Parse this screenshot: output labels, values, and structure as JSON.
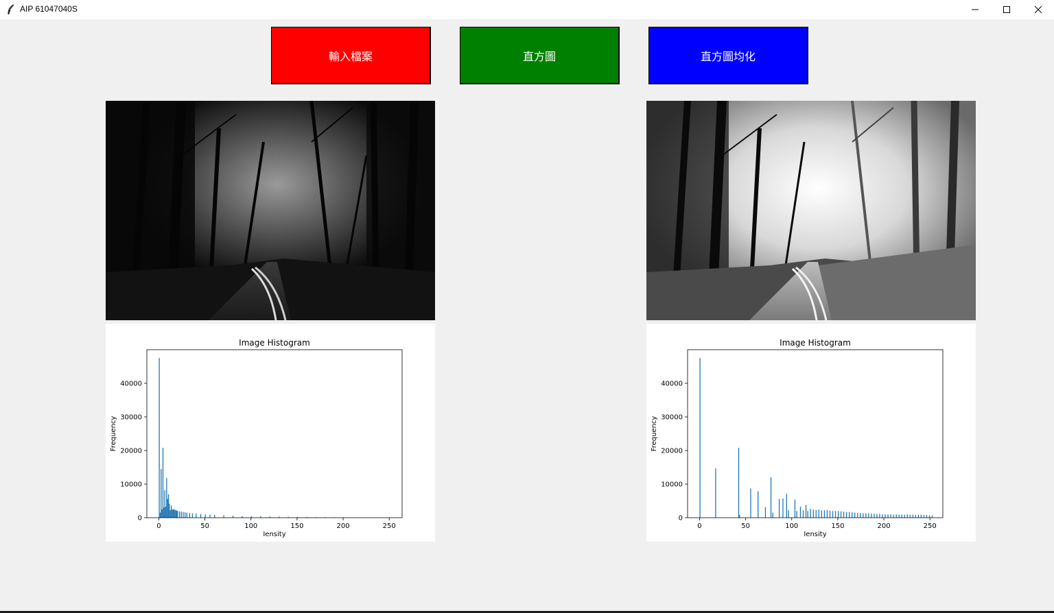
{
  "window": {
    "title": "AIP 61047040S",
    "icon": "feather-icon"
  },
  "toolbar": {
    "input_label": "輸入檔案",
    "histogram_label": "直方圖",
    "equalize_label": "直方圖均化",
    "colors": {
      "input": "#ff0000",
      "histogram": "#008000",
      "equalize": "#0000ff"
    }
  },
  "chart_data": [
    {
      "type": "bar",
      "title": "Image Histogram",
      "xlabel": "Iensity",
      "ylabel": "Frequency",
      "xlim": [
        -13,
        264
      ],
      "ylim": [
        0,
        50000
      ],
      "xticks": [
        0,
        50,
        100,
        150,
        200,
        250
      ],
      "yticks": [
        0,
        10000,
        20000,
        30000,
        40000
      ],
      "color": "#1f77b4",
      "x": [
        0,
        1,
        2,
        3,
        4,
        5,
        6,
        7,
        8,
        9,
        10,
        11,
        12,
        13,
        14,
        15,
        16,
        17,
        18,
        19,
        20,
        22,
        24,
        26,
        28,
        30,
        33,
        36,
        40,
        45,
        50,
        55,
        60,
        70,
        80,
        90,
        100,
        110,
        120,
        130,
        140,
        150,
        160,
        170,
        180,
        190,
        200,
        220,
        240,
        250
      ],
      "values": [
        47500,
        1500,
        14500,
        2500,
        20800,
        3000,
        8200,
        3300,
        11800,
        5600,
        7000,
        4200,
        2200,
        3600,
        2500,
        2400,
        2600,
        2200,
        2300,
        2100,
        2000,
        1900,
        1800,
        1700,
        1600,
        1500,
        1400,
        1300,
        1200,
        1100,
        1000,
        900,
        800,
        700,
        600,
        500,
        450,
        400,
        350,
        300,
        260,
        220,
        200,
        180,
        160,
        140,
        120,
        100,
        80,
        60
      ]
    },
    {
      "type": "bar",
      "title": "Image Histogram",
      "xlabel": "Iensity",
      "ylabel": "Frequency",
      "xlim": [
        -13,
        264
      ],
      "ylim": [
        0,
        50000
      ],
      "xticks": [
        0,
        50,
        100,
        150,
        200,
        250
      ],
      "yticks": [
        0,
        10000,
        20000,
        30000,
        40000
      ],
      "color": "#1f77b4",
      "x": [
        0,
        17,
        42,
        43,
        55,
        63,
        71,
        77,
        79,
        86,
        90,
        94,
        96,
        103,
        105,
        109,
        112,
        115,
        117,
        120,
        123,
        126,
        129,
        132,
        135,
        138,
        141,
        144,
        147,
        150,
        153,
        156,
        159,
        162,
        165,
        168,
        171,
        174,
        177,
        180,
        183,
        186,
        189,
        192,
        195,
        198,
        201,
        204,
        207,
        210,
        213,
        216,
        219,
        222,
        225,
        228,
        231,
        234,
        237,
        240,
        243,
        246,
        249,
        252
      ],
      "values": [
        47500,
        14700,
        20800,
        800,
        8700,
        7900,
        3100,
        12000,
        1500,
        5600,
        5700,
        7100,
        2200,
        5400,
        2000,
        3300,
        2200,
        3800,
        2000,
        2600,
        2400,
        2300,
        2400,
        2200,
        2200,
        2300,
        2100,
        2000,
        2000,
        2000,
        1900,
        1800,
        1700,
        1700,
        1600,
        1500,
        1400,
        1400,
        1300,
        1300,
        1300,
        1200,
        1200,
        1100,
        1100,
        1000,
        1000,
        1000,
        1000,
        900,
        1000,
        900,
        900,
        900,
        1000,
        900,
        900,
        800,
        900,
        900,
        800,
        800,
        700,
        700
      ]
    }
  ]
}
